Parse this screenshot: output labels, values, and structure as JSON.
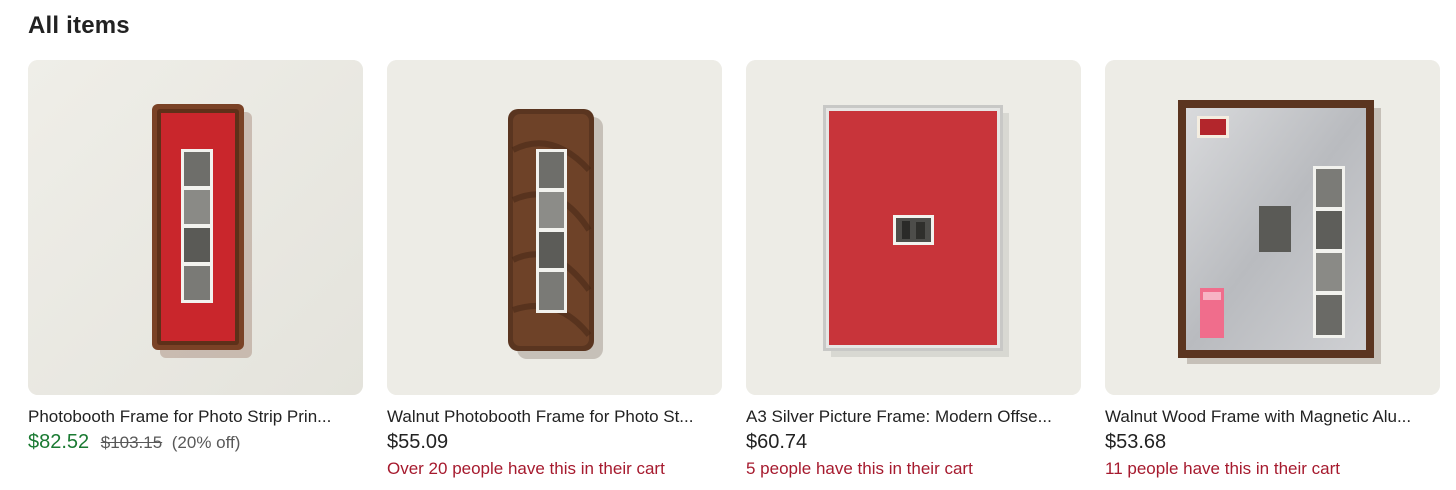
{
  "section": {
    "heading": "All items"
  },
  "colors": {
    "sale_price": "#1a7a32",
    "cart_note": "#a61a2e"
  },
  "items": [
    {
      "title": "Photobooth Frame for Photo Strip Prin...",
      "price": "$82.52",
      "original_price": "$103.15",
      "discount": "(20% off)",
      "note": ""
    },
    {
      "title": "Walnut Photobooth Frame for Photo St...",
      "price": "$55.09",
      "original_price": "",
      "discount": "",
      "note": "Over 20 people have this in their cart"
    },
    {
      "title": "A3 Silver Picture Frame: Modern Offse...",
      "price": "$60.74",
      "original_price": "",
      "discount": "",
      "note": "5 people have this in their cart"
    },
    {
      "title": "Walnut Wood Frame with Magnetic Alu...",
      "price": "$53.68",
      "original_price": "",
      "discount": "",
      "note": "11 people have this in their cart"
    }
  ]
}
